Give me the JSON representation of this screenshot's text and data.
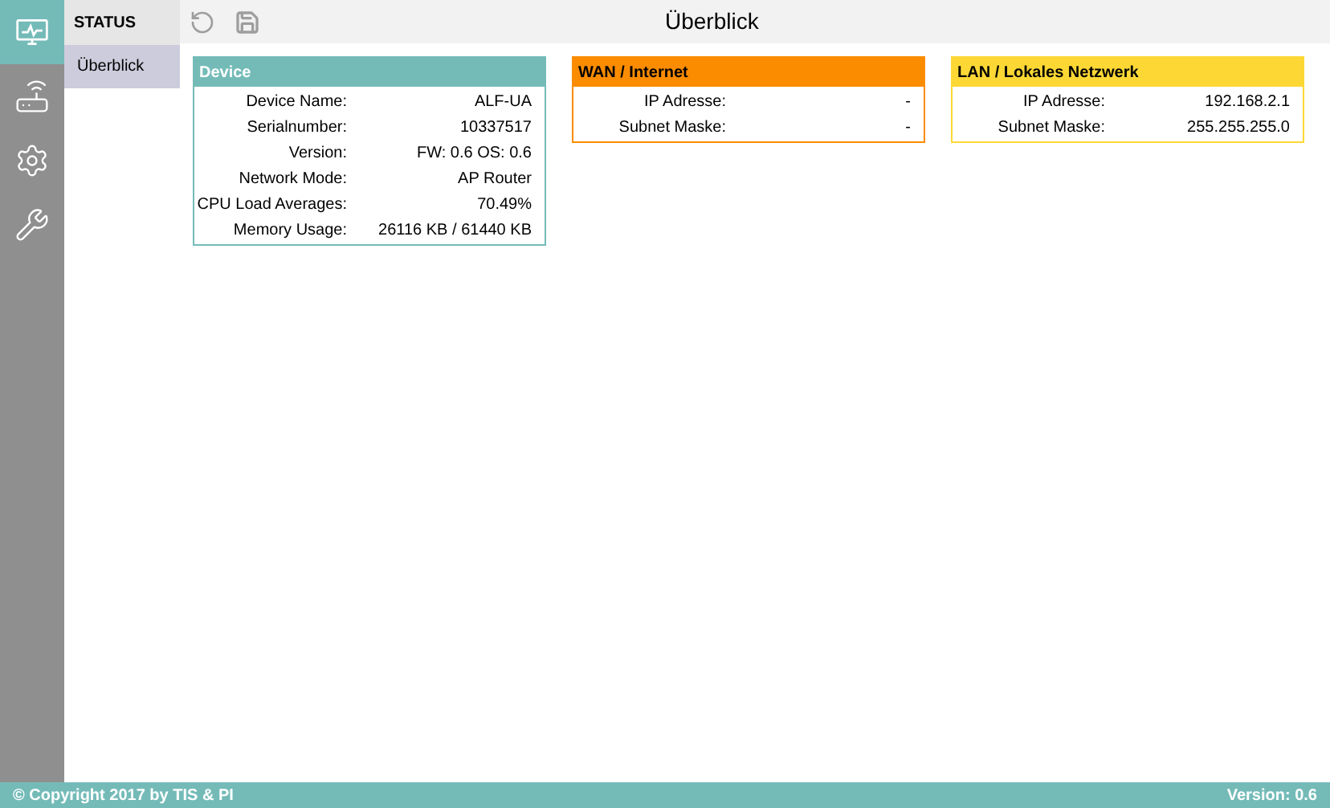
{
  "nav_rail": [
    {
      "kind": "monitor",
      "selected": true
    },
    {
      "kind": "router",
      "selected": false
    },
    {
      "kind": "settings",
      "selected": false
    },
    {
      "kind": "tools",
      "selected": false
    }
  ],
  "submenu": {
    "header": "STATUS",
    "items": [
      {
        "label": "Überblick",
        "selected": true
      }
    ]
  },
  "title": "Überblick",
  "cards": [
    {
      "title": "Device",
      "color": "#74bbb8",
      "rows": [
        {
          "label": "Device Name:",
          "value": "ALF-UA"
        },
        {
          "label": "Serialnumber:",
          "value": "10337517"
        },
        {
          "label": "Version:",
          "value": "FW: 0.6 OS: 0.6"
        },
        {
          "label": "Network Mode:",
          "value": "AP Router"
        },
        {
          "label": "CPU Load Averages:",
          "value": "70.49%"
        },
        {
          "label": "Memory Usage:",
          "value": "26116 KB / 61440 KB"
        }
      ]
    },
    {
      "title": "WAN / Internet",
      "color": "#fb8c00",
      "rows": [
        {
          "label": "IP Adresse:",
          "value": "-"
        },
        {
          "label": "Subnet Maske:",
          "value": "-"
        }
      ]
    },
    {
      "title": "LAN / Lokales Netzwerk",
      "color": "#fdd835",
      "rows": [
        {
          "label": "IP Adresse:",
          "value": "192.168.2.1"
        },
        {
          "label": "Subnet Maske:",
          "value": "255.255.255.0"
        }
      ]
    }
  ],
  "footer": {
    "copyright": "© Copyright 2017 by TIS & PI",
    "version": "Version: 0.6"
  }
}
